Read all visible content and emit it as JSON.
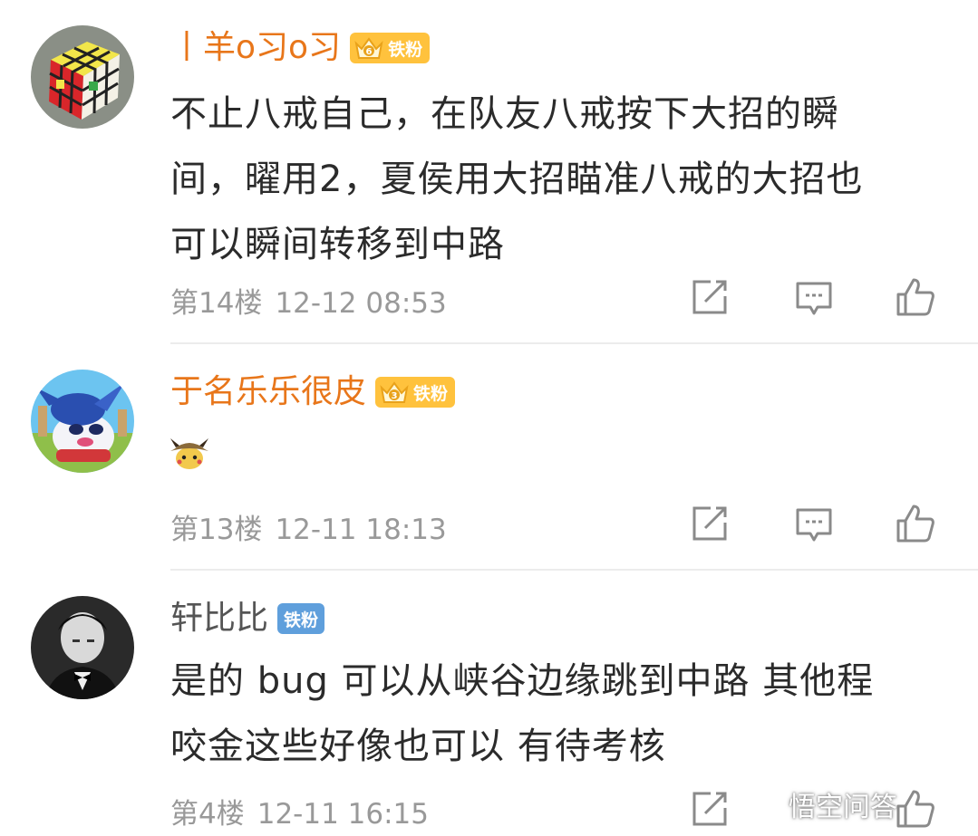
{
  "comments": [
    {
      "username": "丨羊o习o习",
      "badge": "铁粉",
      "badge_level": "6",
      "lines": [
        "不止八戒自己，在队友八戒按下大招的瞬",
        "间，曜用2，夏侯用大招瞄准八戒的大招也",
        "可以瞬间转移到中路"
      ],
      "floor": "第14楼",
      "time": "12-12 08:53"
    },
    {
      "username": "于名乐乐很皮",
      "badge": "铁粉",
      "badge_level": "3",
      "emoji": "detective-pikachu-sticker",
      "floor": "第13楼",
      "time": "12-11 18:13"
    },
    {
      "username": "轩比比",
      "badge": "铁粉",
      "lines": [
        "是的 bug 可以从峡谷边缘跳到中路 其他程",
        "咬金这些好像也可以 有待考核"
      ],
      "floor": "第4楼",
      "time": "12-11 16:15"
    }
  ],
  "actions": [
    "repost-icon",
    "comment-icon",
    "like-icon"
  ],
  "watermark": "悟空问答",
  "colors": {
    "username_highlight": "#e8761a",
    "badge_gold": "#ffc23d",
    "badge_blue": "#5f9fdc",
    "meta_gray": "#999999"
  }
}
